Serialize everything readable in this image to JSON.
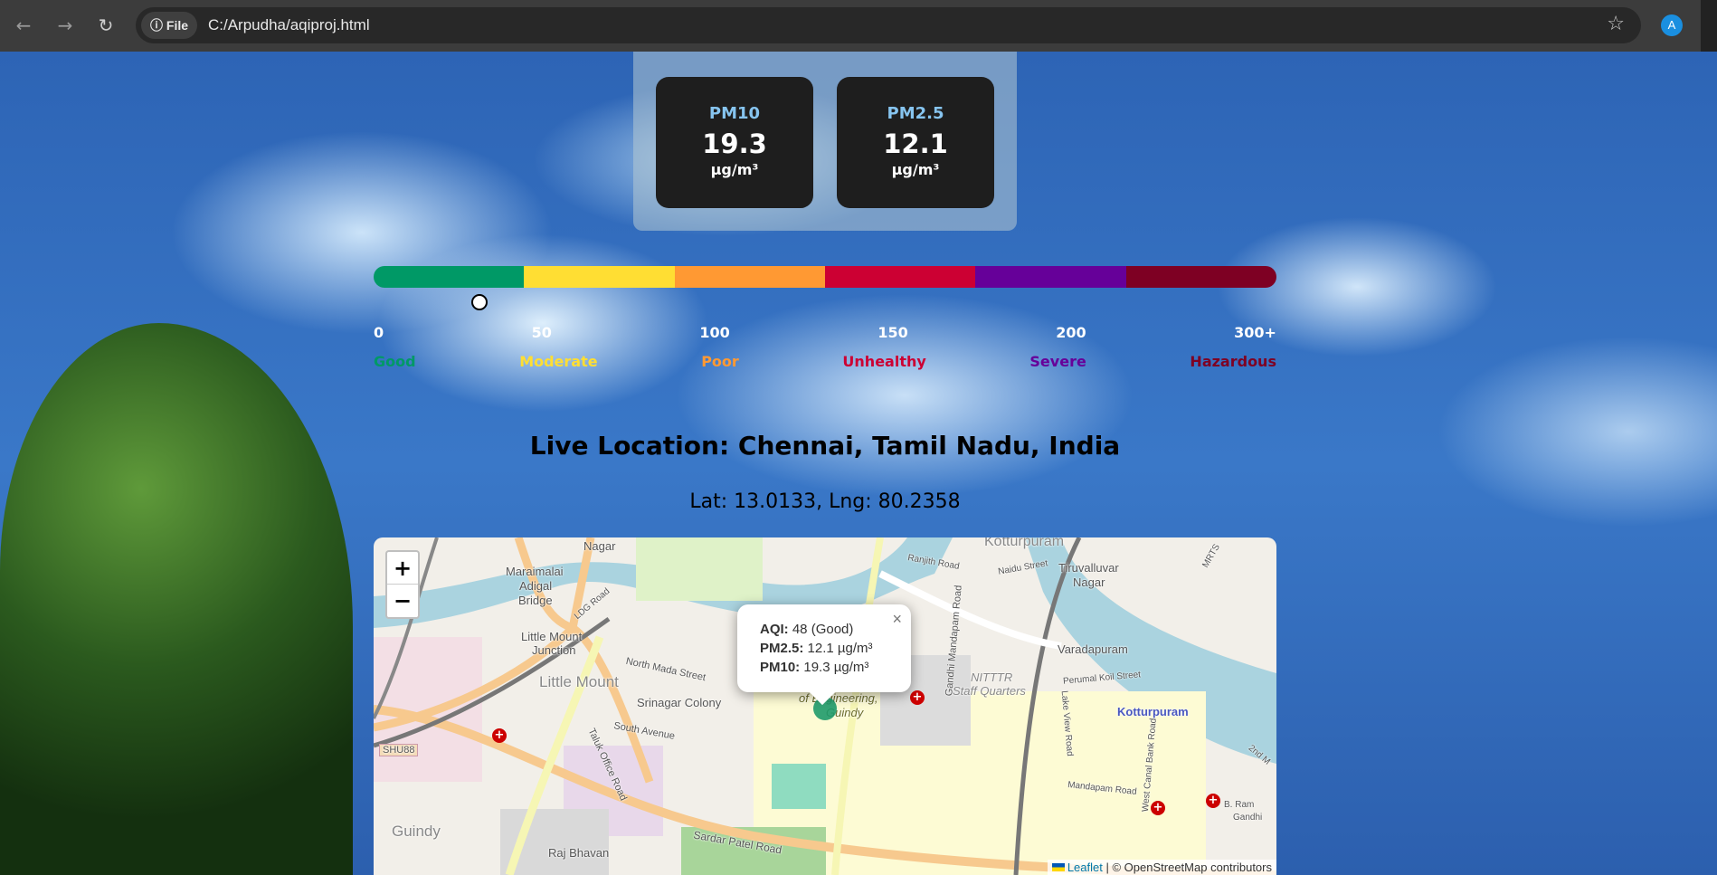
{
  "browser": {
    "chip": "File",
    "url": "C:/Arpudha/aqiproj.html",
    "avatar": "A"
  },
  "cards": [
    {
      "label": "PM10",
      "value": "19.3",
      "unit": "µg/m³"
    },
    {
      "label": "PM2.5",
      "value": "12.1",
      "unit": "µg/m³"
    }
  ],
  "scale": {
    "aqi": 48,
    "max": 300,
    "segments": [
      "#009966",
      "#ffde33",
      "#ff9933",
      "#cc0033",
      "#660099",
      "#7e0023"
    ],
    "ticks": [
      "0",
      "50",
      "100",
      "150",
      "200",
      "300+"
    ],
    "categories": [
      {
        "label": "Good",
        "color": "#009966"
      },
      {
        "label": "Moderate",
        "color": "#ffde33"
      },
      {
        "label": "Poor",
        "color": "#ff9933"
      },
      {
        "label": "Unhealthy",
        "color": "#cc0033"
      },
      {
        "label": "Severe",
        "color": "#660099"
      },
      {
        "label": "Hazardous",
        "color": "#7e0023"
      }
    ]
  },
  "location": {
    "title": "Live Location: Chennai, Tamil Nadu, India",
    "coords": "Lat: 13.0133, Lng: 80.2358"
  },
  "map": {
    "zoom_in": "+",
    "zoom_out": "−",
    "popup": {
      "aqi_label": "AQI:",
      "aqi_value": "48 (Good)",
      "pm25_label": "PM2.5:",
      "pm25_value": "12.1 µg/m³",
      "pm10_label": "PM10:",
      "pm10_value": "19.3 µg/m³",
      "close": "×"
    },
    "attribution": {
      "leaflet": "Leaflet",
      "osm": "| © OpenStreetMap contributors"
    },
    "labels": [
      "Nagar",
      "Maraimalai",
      "Adigal",
      "Bridge",
      "Little Mount",
      "Junction",
      "Little Mount",
      "North Mada Street",
      "Srinagar Colony",
      "South Avenue",
      "Taluk Office Road",
      "SHU88",
      "Guindy",
      "Raj Bhavan",
      "Sardar Patel Road",
      "Kotturpuram",
      "Ranjith Road",
      "Naidu Street",
      "Tiruvalluvar",
      "Nagar",
      "Gandhi Mandapam Road",
      "Varadapuram",
      "NITTTR",
      "Staff Quarters",
      "Perumal Koil Street",
      "Kotturpuram",
      "Lake View Road",
      "Mandapam Road",
      "West Canal Bank Road",
      "LDG Road",
      "of Engineering,",
      "Guindy",
      "B. Ram",
      "Gandhi",
      "2nd M",
      "MRTS"
    ]
  }
}
